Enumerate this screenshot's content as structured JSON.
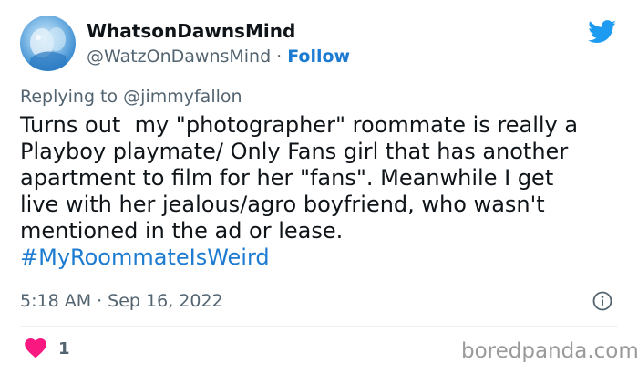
{
  "user": {
    "display_name": "WhatsonDawnsMind",
    "handle": "@WatzOnDawnsMind",
    "separator": "·",
    "follow_label": "Follow"
  },
  "reply": {
    "prefix": "Replying to",
    "mention": "@jimmyfallon"
  },
  "tweet": {
    "lines": [
      "Turns out  my \"photographer\" roommate is really a",
      "Playboy playmate/ Only Fans girl that has another",
      "apartment to film for her \"fans\". Meanwhile I get",
      "live with her jealous/agro boyfriend, who wasn't",
      "mentioned in the ad or lease."
    ],
    "hashtag": "#MyRoommateIsWeird"
  },
  "meta": {
    "time": "5:18 AM",
    "separator": "·",
    "date": "Sep 16, 2022"
  },
  "engagement": {
    "like_count": "1"
  },
  "watermark": "boredpanda.com",
  "colors": {
    "accent": "#1d7bd1",
    "twitter_blue": "#1d9bf0",
    "heart": "#f91880",
    "muted": "#536471"
  },
  "icons": {
    "brand": "twitter-bird-icon",
    "info": "info-icon",
    "like": "heart-icon"
  }
}
